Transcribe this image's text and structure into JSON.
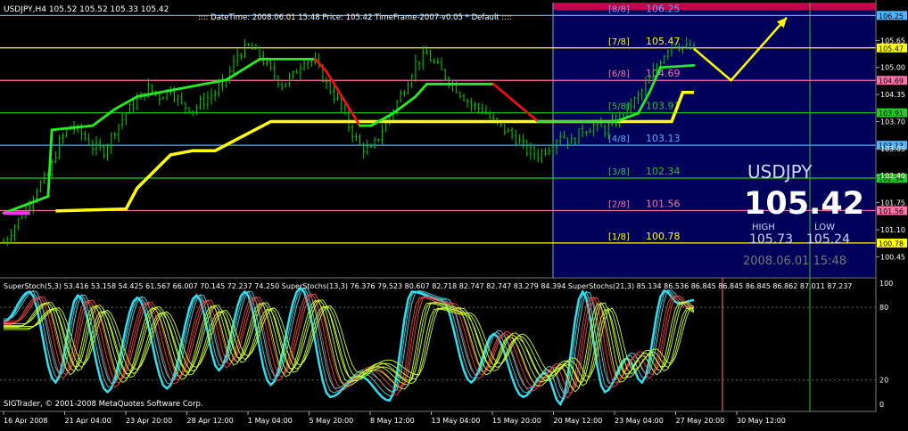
{
  "window": {
    "symbol_header": "USDJPY,H4  105.52 105.52 105.33 105.42",
    "info_line": ":::: DateTime: 2008.06.01 15:48    Price: 105.42    TimeFrame-2007-v0.05    *  Default  ::::"
  },
  "info_panel": {
    "symbol": "USDJPY",
    "price": "105.42",
    "high_label": "HIGH",
    "low_label": "LOW",
    "high_value": "105.73",
    "low_value": "105.24",
    "timestamp": "2008.06.01 15:48"
  },
  "murrey_levels": [
    {
      "label": "[8/8]",
      "value": "106.25",
      "price": 106.25,
      "color": "#4fb3ff"
    },
    {
      "label": "[7/8]",
      "value": "105.47",
      "price": 105.47,
      "color": "#ffff00"
    },
    {
      "label": "[6/8]",
      "value": "104.69",
      "price": 104.69,
      "color": "#ff6fa8"
    },
    {
      "label": "[5/8]",
      "value": "103.91",
      "price": 103.91,
      "color": "#22cc22"
    },
    {
      "label": "[4/8]",
      "value": "103.13",
      "price": 103.13,
      "color": "#4fb3ff"
    },
    {
      "label": "[3/8]",
      "value": "102.34",
      "price": 102.34,
      "color": "#22cc22"
    },
    {
      "label": "[2/8]",
      "value": "101.56",
      "price": 101.56,
      "color": "#ff6fa8"
    },
    {
      "label": "[1/8]",
      "value": "100.78",
      "price": 100.78,
      "color": "#ffff00"
    }
  ],
  "price_axis": {
    "ticks": [
      "105.65",
      "105.00",
      "104.35",
      "103.70",
      "103.05",
      "102.40",
      "101.75",
      "101.10",
      "100.45"
    ],
    "tick_values": [
      105.65,
      105.0,
      104.35,
      103.7,
      103.05,
      102.4,
      101.75,
      101.1,
      100.45
    ],
    "range": [
      100.2,
      106.45
    ]
  },
  "indicator": {
    "label": "SuperStoch(5,3) 53.416 53.158 54.425 61.567 66.007 70.145 72.237 74.250   SuperStochs(13,3) 76.376 79.523 80.607 82.718 82.747 82.747 83.279 84.394   SuperStochs(21,3) 85.134 86.536 86.845 86.845 86.845 86.862 87.011 87.237",
    "axis_ticks": [
      "100",
      "80",
      "20",
      "0"
    ],
    "axis_values": [
      100,
      80,
      20,
      0
    ],
    "range": [
      -3,
      100
    ]
  },
  "time_axis": {
    "labels": [
      "16 Apr 2008",
      "21 Apr 04:00",
      "23 Apr 20:00",
      "28 Apr 12:00",
      "1 May 04:00",
      "5 May 20:00",
      "8 May 12:00",
      "13 May 04:00",
      "15 May 20:00",
      "20 May 12:00",
      "23 May 04:00",
      "27 May 20:00",
      "30 May 12:00"
    ]
  },
  "footer": {
    "copyright": "SIGTrader, © 2001-2008 MetaQuotes Software Corp."
  },
  "colors": {
    "background": "#000000",
    "projection_zone": "#00005a",
    "frame_top": "#c8004a",
    "candles": "#00d000",
    "trend_green": "#22ee22",
    "trend_red": "#ee1111",
    "trend_yellow": "#ffff00",
    "stoch_cyan": "#33ddee",
    "stoch_red": "#ff2222",
    "stoch_lime": "#ccff33"
  },
  "chart_data": {
    "type": "candlestick",
    "symbol": "USDJPY",
    "timeframe": "H4",
    "price_range": [
      100.2,
      106.45
    ],
    "close_path": [
      [
        0,
        100.8
      ],
      [
        3,
        101.2
      ],
      [
        6,
        101.6
      ],
      [
        9,
        102.1
      ],
      [
        12,
        102.4
      ],
      [
        15,
        103.2
      ],
      [
        18,
        103.6
      ],
      [
        21,
        103.4
      ],
      [
        24,
        103.1
      ],
      [
        27,
        103.0
      ],
      [
        30,
        103.5
      ],
      [
        33,
        103.9
      ],
      [
        36,
        104.2
      ],
      [
        39,
        104.5
      ],
      [
        42,
        104.3
      ],
      [
        45,
        104.5
      ],
      [
        48,
        104.1
      ],
      [
        51,
        104.0
      ],
      [
        54,
        104.2
      ],
      [
        57,
        104.4
      ],
      [
        60,
        104.7
      ],
      [
        63,
        105.3
      ],
      [
        66,
        105.5
      ],
      [
        69,
        105.3
      ],
      [
        72,
        104.9
      ],
      [
        75,
        104.6
      ],
      [
        78,
        104.8
      ],
      [
        81,
        105.2
      ],
      [
        84,
        105.1
      ],
      [
        87,
        104.6
      ],
      [
        90,
        104.2
      ],
      [
        93,
        103.6
      ],
      [
        96,
        103.1
      ],
      [
        99,
        103.0
      ],
      [
        102,
        103.5
      ],
      [
        105,
        104.0
      ],
      [
        108,
        104.5
      ],
      [
        111,
        105.1
      ],
      [
        114,
        105.3
      ],
      [
        117,
        105.0
      ],
      [
        120,
        104.7
      ],
      [
        123,
        104.4
      ],
      [
        126,
        104.1
      ],
      [
        129,
        104.0
      ],
      [
        132,
        103.7
      ],
      [
        135,
        103.5
      ],
      [
        138,
        103.3
      ],
      [
        141,
        103.0
      ],
      [
        144,
        102.9
      ],
      [
        147,
        103.1
      ],
      [
        150,
        103.4
      ],
      [
        153,
        103.2
      ],
      [
        156,
        103.5
      ],
      [
        159,
        103.6
      ],
      [
        162,
        103.5
      ],
      [
        165,
        103.7
      ],
      [
        168,
        104.0
      ],
      [
        171,
        104.3
      ],
      [
        174,
        104.7
      ],
      [
        177,
        105.2
      ],
      [
        180,
        105.6
      ],
      [
        183,
        105.5
      ],
      [
        186,
        105.42
      ]
    ],
    "projection_arrow": [
      [
        186,
        105.45
      ],
      [
        196,
        104.69
      ],
      [
        211,
        106.2
      ]
    ],
    "trend_green": [
      [
        0,
        101.5
      ],
      [
        12,
        101.9
      ],
      [
        13,
        103.5
      ],
      [
        24,
        103.6
      ],
      [
        30,
        104.0
      ],
      [
        36,
        104.3
      ],
      [
        48,
        104.5
      ],
      [
        60,
        104.7
      ],
      [
        69,
        105.2
      ],
      [
        75,
        105.2
      ],
      [
        84,
        105.2
      ],
      [
        87,
        104.9
      ],
      [
        96,
        103.6
      ],
      [
        99,
        103.6
      ],
      [
        105,
        103.9
      ],
      [
        111,
        104.3
      ],
      [
        114,
        104.6
      ],
      [
        117,
        104.6
      ],
      [
        132,
        104.6
      ],
      [
        144,
        103.7
      ],
      [
        165,
        103.7
      ],
      [
        171,
        103.9
      ],
      [
        174,
        104.4
      ],
      [
        177,
        105.0
      ],
      [
        186,
        105.05
      ]
    ],
    "trend_yellow": [
      [
        14,
        101.55
      ],
      [
        33,
        101.6
      ],
      [
        36,
        102.1
      ],
      [
        45,
        102.9
      ],
      [
        51,
        103.0
      ],
      [
        57,
        103.0
      ],
      [
        72,
        103.7
      ],
      [
        108,
        103.7
      ],
      [
        111,
        103.7
      ],
      [
        180,
        103.7
      ],
      [
        183,
        104.4
      ],
      [
        186,
        104.4
      ]
    ],
    "stoch_5_3": [
      53.416,
      53.158,
      54.425,
      61.567,
      66.007,
      70.145,
      72.237,
      74.25
    ],
    "stoch_13_3": [
      76.376,
      79.523,
      80.607,
      82.718,
      82.747,
      82.747,
      83.279,
      84.394
    ],
    "stoch_21_3": [
      85.134,
      86.536,
      86.845,
      86.845,
      86.845,
      86.862,
      87.011,
      87.237
    ]
  }
}
